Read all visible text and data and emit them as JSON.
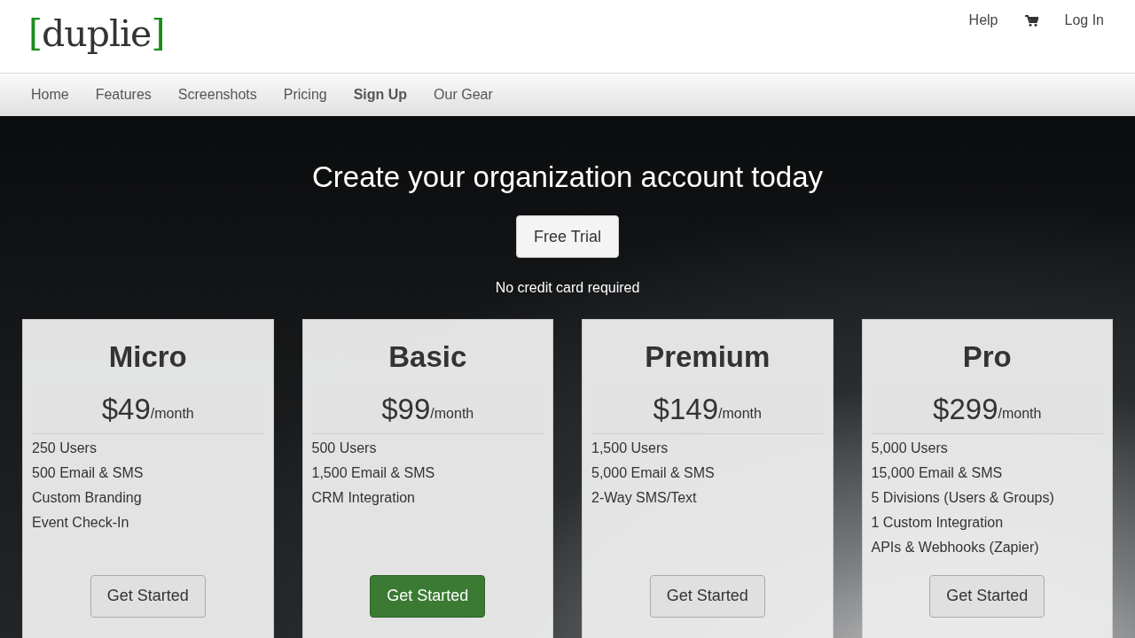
{
  "logo": {
    "open": "[",
    "text": "duplie",
    "close": "]"
  },
  "top_links": [
    {
      "kind": "text",
      "label": "Help"
    },
    {
      "kind": "cart"
    },
    {
      "kind": "text",
      "label": "Log In"
    }
  ],
  "nav": [
    {
      "label": "Home",
      "selected": false
    },
    {
      "label": "Features",
      "selected": false
    },
    {
      "label": "Screenshots",
      "selected": false
    },
    {
      "label": "Pricing",
      "selected": false
    },
    {
      "label": "Sign Up",
      "selected": true
    },
    {
      "label": "Our Gear",
      "selected": false
    }
  ],
  "hero": {
    "title": "Create your organization account today",
    "button": "Free Trial",
    "note": "No credit card required"
  },
  "plans": [
    {
      "name": "Micro",
      "price": "$49",
      "period": "/month",
      "features": [
        "250 Users",
        "500 Email & SMS",
        "Custom Branding",
        "Event Check-In"
      ],
      "button": "Get Started",
      "featured": false
    },
    {
      "name": "Basic",
      "price": "$99",
      "period": "/month",
      "features": [
        "500 Users",
        "1,500 Email & SMS",
        "CRM Integration"
      ],
      "button": "Get Started",
      "featured": true
    },
    {
      "name": "Premium",
      "price": "$149",
      "period": "/month",
      "features": [
        "1,500 Users",
        "5,000 Email & SMS",
        "2-Way SMS/Text"
      ],
      "button": "Get Started",
      "featured": false
    },
    {
      "name": "Pro",
      "price": "$299",
      "period": "/month",
      "features": [
        "5,000 Users",
        "15,000 Email & SMS",
        "5 Divisions (Users & Groups)",
        "1 Custom Integration",
        "APIs & Webhooks (Zapier)"
      ],
      "button": "Get Started",
      "featured": false
    }
  ]
}
